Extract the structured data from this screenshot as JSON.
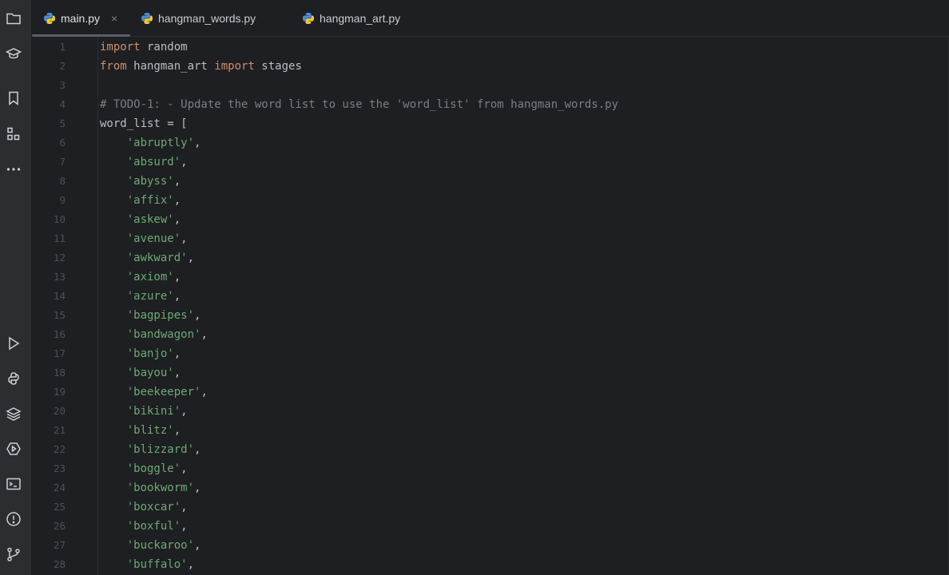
{
  "window": {
    "accent": "#5c5f66",
    "background": "#1e1f22"
  },
  "toolstrip": {
    "top": [
      {
        "name": "project-icon"
      },
      {
        "name": "learn-icon"
      },
      {
        "name": "bookmarks-icon"
      },
      {
        "name": "structure-icon"
      },
      {
        "name": "more-icon"
      }
    ],
    "bottom": [
      {
        "name": "run-icon"
      },
      {
        "name": "python-console-icon"
      },
      {
        "name": "layers-icon"
      },
      {
        "name": "services-icon"
      },
      {
        "name": "terminal-icon"
      },
      {
        "name": "problems-icon"
      },
      {
        "name": "git-icon"
      }
    ]
  },
  "tabs": [
    {
      "label": "main.py",
      "active": true
    },
    {
      "label": "hangman_words.py",
      "active": false
    },
    {
      "label": "hangman_art.py",
      "active": false
    }
  ],
  "tab_close_glyph": "×",
  "editor": {
    "lines": [
      {
        "n": "1",
        "tokens": [
          {
            "t": "kw",
            "v": "import"
          },
          {
            "t": "p",
            "v": " random"
          }
        ]
      },
      {
        "n": "2",
        "tokens": [
          {
            "t": "kw",
            "v": "from"
          },
          {
            "t": "p",
            "v": " hangman_art "
          },
          {
            "t": "kw",
            "v": "import"
          },
          {
            "t": "p",
            "v": " stages"
          }
        ]
      },
      {
        "n": "3",
        "tokens": []
      },
      {
        "n": "4",
        "tokens": [
          {
            "t": "cmt",
            "v": "# TODO-1: - Update the word list to use the 'word_list' from hangman_words.py"
          }
        ]
      },
      {
        "n": "5",
        "tokens": [
          {
            "t": "p",
            "v": "word_list = ["
          }
        ]
      },
      {
        "n": "6",
        "tokens": [
          {
            "t": "p",
            "v": "    "
          },
          {
            "t": "str",
            "v": "'abruptly'"
          },
          {
            "t": "p",
            "v": ","
          }
        ]
      },
      {
        "n": "7",
        "tokens": [
          {
            "t": "p",
            "v": "    "
          },
          {
            "t": "str",
            "v": "'absurd'"
          },
          {
            "t": "p",
            "v": ","
          }
        ]
      },
      {
        "n": "8",
        "tokens": [
          {
            "t": "p",
            "v": "    "
          },
          {
            "t": "str",
            "v": "'abyss'"
          },
          {
            "t": "p",
            "v": ","
          }
        ]
      },
      {
        "n": "9",
        "tokens": [
          {
            "t": "p",
            "v": "    "
          },
          {
            "t": "str",
            "v": "'affix'"
          },
          {
            "t": "p",
            "v": ","
          }
        ]
      },
      {
        "n": "10",
        "tokens": [
          {
            "t": "p",
            "v": "    "
          },
          {
            "t": "str",
            "v": "'askew'"
          },
          {
            "t": "p",
            "v": ","
          }
        ]
      },
      {
        "n": "11",
        "tokens": [
          {
            "t": "p",
            "v": "    "
          },
          {
            "t": "str",
            "v": "'avenue'"
          },
          {
            "t": "p",
            "v": ","
          }
        ]
      },
      {
        "n": "12",
        "tokens": [
          {
            "t": "p",
            "v": "    "
          },
          {
            "t": "str",
            "v": "'awkward'"
          },
          {
            "t": "p",
            "v": ","
          }
        ]
      },
      {
        "n": "13",
        "tokens": [
          {
            "t": "p",
            "v": "    "
          },
          {
            "t": "str",
            "v": "'axiom'"
          },
          {
            "t": "p",
            "v": ","
          }
        ]
      },
      {
        "n": "14",
        "tokens": [
          {
            "t": "p",
            "v": "    "
          },
          {
            "t": "str",
            "v": "'azure'"
          },
          {
            "t": "p",
            "v": ","
          }
        ]
      },
      {
        "n": "15",
        "tokens": [
          {
            "t": "p",
            "v": "    "
          },
          {
            "t": "str",
            "v": "'bagpipes'"
          },
          {
            "t": "p",
            "v": ","
          }
        ]
      },
      {
        "n": "16",
        "tokens": [
          {
            "t": "p",
            "v": "    "
          },
          {
            "t": "str",
            "v": "'bandwagon'"
          },
          {
            "t": "p",
            "v": ","
          }
        ]
      },
      {
        "n": "17",
        "tokens": [
          {
            "t": "p",
            "v": "    "
          },
          {
            "t": "str",
            "v": "'banjo'"
          },
          {
            "t": "p",
            "v": ","
          }
        ]
      },
      {
        "n": "18",
        "tokens": [
          {
            "t": "p",
            "v": "    "
          },
          {
            "t": "str",
            "v": "'bayou'"
          },
          {
            "t": "p",
            "v": ","
          }
        ]
      },
      {
        "n": "19",
        "tokens": [
          {
            "t": "p",
            "v": "    "
          },
          {
            "t": "str",
            "v": "'beekeeper'"
          },
          {
            "t": "p",
            "v": ","
          }
        ]
      },
      {
        "n": "20",
        "tokens": [
          {
            "t": "p",
            "v": "    "
          },
          {
            "t": "str",
            "v": "'bikini'"
          },
          {
            "t": "p",
            "v": ","
          }
        ]
      },
      {
        "n": "21",
        "tokens": [
          {
            "t": "p",
            "v": "    "
          },
          {
            "t": "str",
            "v": "'blitz'"
          },
          {
            "t": "p",
            "v": ","
          }
        ]
      },
      {
        "n": "22",
        "tokens": [
          {
            "t": "p",
            "v": "    "
          },
          {
            "t": "str",
            "v": "'blizzard'"
          },
          {
            "t": "p",
            "v": ","
          }
        ]
      },
      {
        "n": "23",
        "tokens": [
          {
            "t": "p",
            "v": "    "
          },
          {
            "t": "str",
            "v": "'boggle'"
          },
          {
            "t": "p",
            "v": ","
          }
        ]
      },
      {
        "n": "24",
        "tokens": [
          {
            "t": "p",
            "v": "    "
          },
          {
            "t": "str",
            "v": "'bookworm'"
          },
          {
            "t": "p",
            "v": ","
          }
        ]
      },
      {
        "n": "25",
        "tokens": [
          {
            "t": "p",
            "v": "    "
          },
          {
            "t": "str",
            "v": "'boxcar'"
          },
          {
            "t": "p",
            "v": ","
          }
        ]
      },
      {
        "n": "26",
        "tokens": [
          {
            "t": "p",
            "v": "    "
          },
          {
            "t": "str",
            "v": "'boxful'"
          },
          {
            "t": "p",
            "v": ","
          }
        ]
      },
      {
        "n": "27",
        "tokens": [
          {
            "t": "p",
            "v": "    "
          },
          {
            "t": "str",
            "v": "'buckaroo'"
          },
          {
            "t": "p",
            "v": ","
          }
        ]
      },
      {
        "n": "28",
        "tokens": [
          {
            "t": "p",
            "v": "    "
          },
          {
            "t": "str",
            "v": "'buffalo'"
          },
          {
            "t": "p",
            "v": ","
          }
        ]
      }
    ]
  }
}
